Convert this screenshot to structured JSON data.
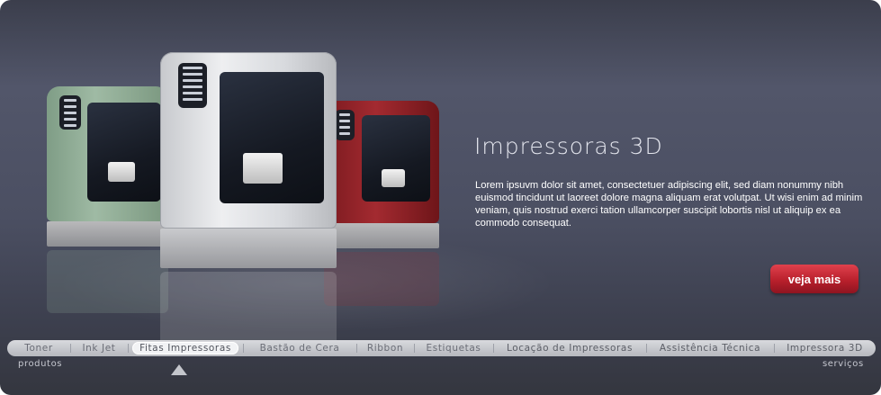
{
  "hero": {
    "title": "Impressoras 3D",
    "description": "Lorem ipsuvm dolor sit amet, consectetuer adipiscing elit, sed diam nonummy nibh euismod tincidunt ut laoreet dolore magna aliquam erat volutpat. Ut wisi enim ad minim veniam, quis nostrud exerci tation ullamcorper suscipit lobortis nisl ut aliquip ex ea commodo consequat.",
    "cta_label": "veja mais",
    "cta_color": "#c12533"
  },
  "nav": {
    "items": [
      {
        "label": "Toner"
      },
      {
        "label": "Ink Jet"
      },
      {
        "label": "Fitas Impressoras",
        "active": true
      },
      {
        "label": "Bastão de Cera"
      },
      {
        "label": "Ribbon"
      },
      {
        "label": "Estiquetas"
      },
      {
        "label": "Locação de Impressoras"
      },
      {
        "label": "Assistência Técnica"
      },
      {
        "label": "Impressora 3D"
      }
    ],
    "left_caption": "produtos",
    "right_caption": "serviços"
  },
  "printers": [
    {
      "color": "green",
      "hex": "#8fae95"
    },
    {
      "color": "white",
      "hex": "#e6e7ea"
    },
    {
      "color": "red",
      "hex": "#9a2228"
    }
  ]
}
